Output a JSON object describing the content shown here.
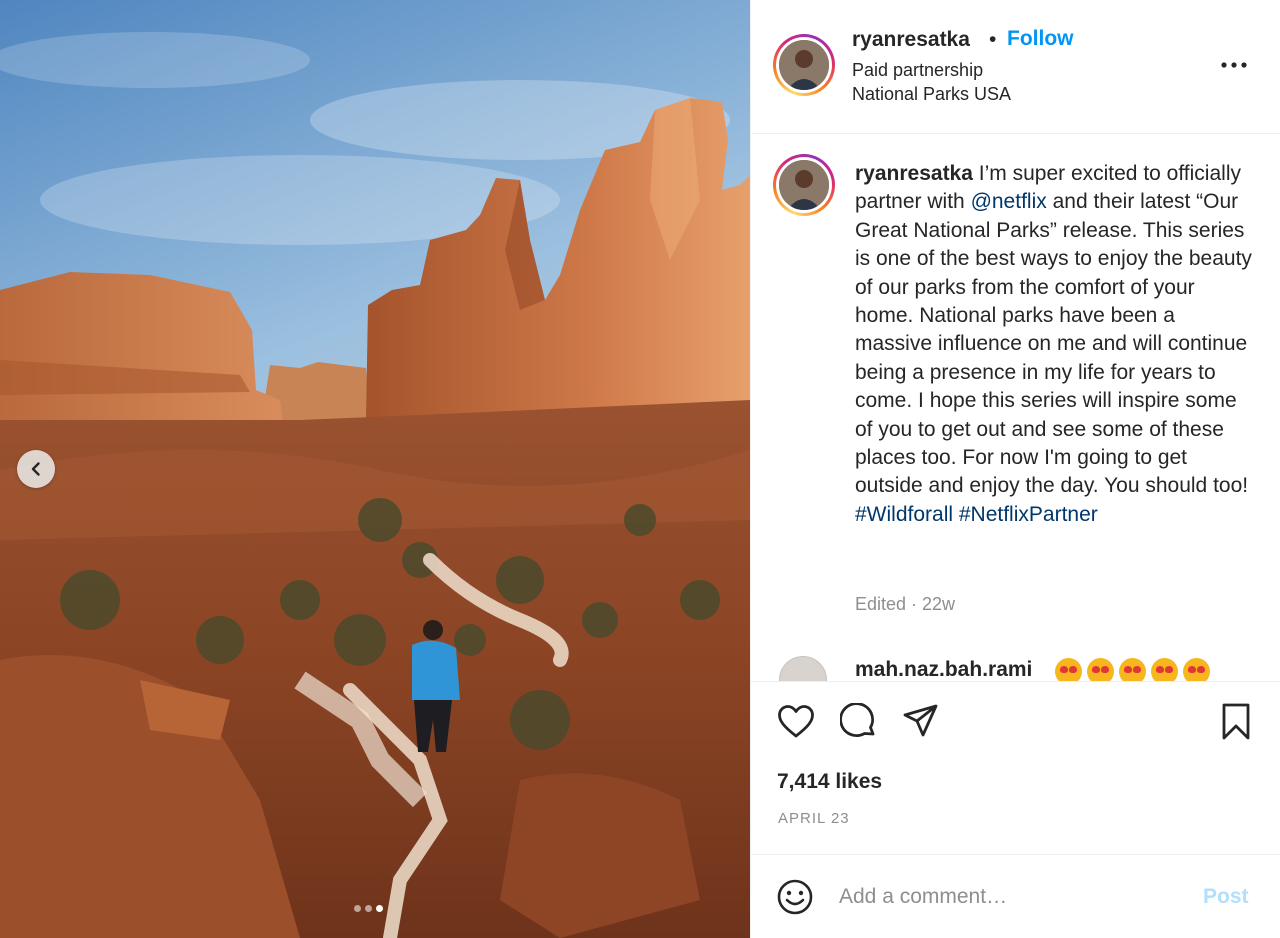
{
  "post": {
    "author": {
      "username": "ryanresatka",
      "separator": "•",
      "follow_label": "Follow",
      "subtitle_1": "Paid partnership",
      "subtitle_2": "National Parks USA"
    },
    "header_more_icon": "more-horizontal-icon",
    "media": {
      "prev_icon": "chevron-left-icon",
      "slide_count": 3,
      "active_slide": 3
    },
    "caption": {
      "username": "ryanresatka",
      "text_1": " I’m super excited to officially partner with ",
      "mention": "@netflix",
      "text_2": " and their latest “Our Great National Parks” release. This series is one of the best ways to enjoy the beauty of our parks from the comfort of your home. National parks have been a massive influence on me and will continue being a presence in my life for years to come. I hope this series will inspire some of you to get out and see some of these places too. For now I'm going to get outside and enjoy the day. You should too!",
      "hashtags": "#Wildforall #NetflixPartner",
      "meta": "Edited · 22w"
    },
    "comment_preview": {
      "username": "mah.naz.bah.rami",
      "emoji_count": 5,
      "emoji_icon": "heart-eyes-emoji-icon"
    },
    "actions": {
      "like_icon": "heart-icon",
      "comment_icon": "comment-icon",
      "share_icon": "share-icon",
      "save_icon": "bookmark-icon"
    },
    "likes": "7,414 likes",
    "date": "APRIL 23",
    "comment_box": {
      "emoji_icon": "smiley-icon",
      "placeholder": "Add a comment…",
      "post_label": "Post"
    },
    "colors": {
      "follow": "#0095f6",
      "link": "#00376b",
      "muted": "#8e8e8e",
      "post_disabled": "#b2dffc"
    }
  }
}
